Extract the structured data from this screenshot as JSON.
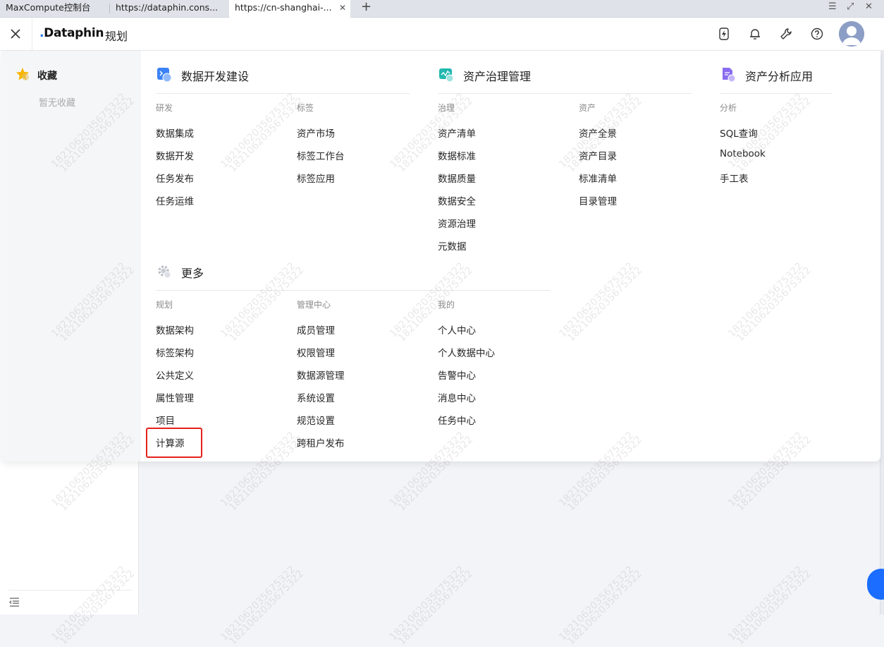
{
  "browser": {
    "tabs": [
      {
        "label": "MaxCompute控制台"
      },
      {
        "label": "https://dataphin.cons..."
      },
      {
        "label": "https://cn-shanghai-..."
      }
    ],
    "close_glyph": "✕",
    "newtab_glyph": "+",
    "win_menu_glyph": "☰",
    "win_restore_glyph": "⤢",
    "win_close_glyph": "✕"
  },
  "header": {
    "logo_prefix": ".",
    "logo_text": "Dataphin",
    "title": "规划"
  },
  "favorites": {
    "title": "收藏",
    "empty_text": "暂无收藏"
  },
  "sections": {
    "dev": {
      "title": "数据开发建设",
      "col1": {
        "head": "研发",
        "items": [
          "数据集成",
          "数据开发",
          "任务发布",
          "任务运维"
        ]
      },
      "col2": {
        "head": "标签",
        "items": [
          "资产市场",
          "标签工作台",
          "标签应用"
        ]
      }
    },
    "gov": {
      "title": "资产治理管理",
      "col1": {
        "head": "治理",
        "items": [
          "资产清单",
          "数据标准",
          "数据质量",
          "数据安全",
          "资源治理",
          "元数据"
        ]
      },
      "col2": {
        "head": "资产",
        "items": [
          "资产全景",
          "资产目录",
          "标准清单",
          "目录管理"
        ]
      }
    },
    "ana": {
      "title": "资产分析应用",
      "col1": {
        "head": "分析",
        "items": [
          "SQL查询",
          "Notebook",
          "手工表"
        ]
      }
    },
    "more": {
      "title": "更多",
      "col1": {
        "head": "规划",
        "items": [
          "数据架构",
          "标签架构",
          "公共定义",
          "属性管理",
          "项目",
          "计算源"
        ]
      },
      "col2": {
        "head": "管理中心",
        "items": [
          "成员管理",
          "权限管理",
          "数据源管理",
          "系统设置",
          "规范设置",
          "跨租户发布"
        ]
      },
      "col3": {
        "head": "我的",
        "items": [
          "个人中心",
          "个人数据中心",
          "告警中心",
          "消息中心",
          "任务中心"
        ]
      }
    }
  },
  "watermark": "1821062035675322",
  "colors": {
    "highlight": "#e5211b",
    "accent": "#1a6dff"
  }
}
